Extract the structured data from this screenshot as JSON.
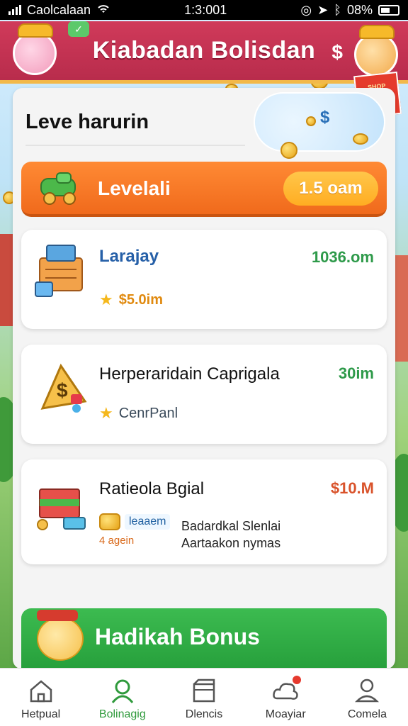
{
  "status_bar": {
    "carrier": "Caolcalaan",
    "time": "1:3:001",
    "battery": "08%"
  },
  "header": {
    "title": "Kiabadan Bolisdan",
    "dollar_icon": "$",
    "shop_sign": "SHOP"
  },
  "main": {
    "level_title": "Leve harurin",
    "level_bar": {
      "label": "Levelali",
      "value": "1.5 oam"
    },
    "cards": [
      {
        "title": "Larajay",
        "value": "1036.om",
        "sub_text": "$5.0im",
        "value_color": "#2e9a4a",
        "title_color": "#2660a8"
      },
      {
        "title": "Herperaridain Caprigala",
        "value": "30im",
        "sub_text": "CenrPanl",
        "value_color": "#2e9a4a",
        "title_color": "#111111"
      },
      {
        "title": "Ratieola Bgial",
        "value": "$10.M",
        "badge": "leaaem",
        "badge_sub": "4 agein",
        "description_line1": "Badardkal Slenlai",
        "description_line2": "Aartaakon nymas",
        "value_color": "#d9532b",
        "title_color": "#111111"
      }
    ]
  },
  "bonus_button": {
    "label": "Hadikah Bonus"
  },
  "bottom_nav": {
    "items": [
      {
        "label": "Hetpual",
        "icon": "home-icon"
      },
      {
        "label": "Bolinagig",
        "icon": "user-icon"
      },
      {
        "label": "Dlencis",
        "icon": "box-icon"
      },
      {
        "label": "Moayiar",
        "icon": "cloud-icon"
      },
      {
        "label": "Comela",
        "icon": "person-icon"
      }
    ],
    "active_index": 1
  }
}
